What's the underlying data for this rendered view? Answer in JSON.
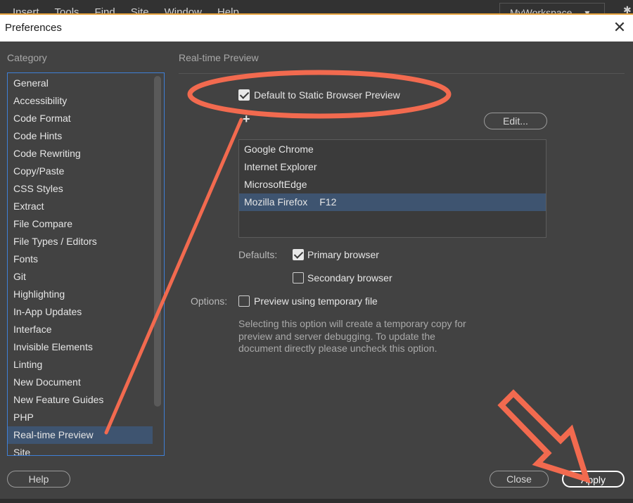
{
  "app_menu": {
    "items": [
      "Insert",
      "Tools",
      "Find",
      "Site",
      "Window",
      "Help"
    ],
    "workspace": "MyWorkspace",
    "workspace_arrow": "▾",
    "gear_glyph": "✱"
  },
  "dialog": {
    "title": "Preferences",
    "close_glyph": "✕",
    "category_label": "Category",
    "categories": [
      "General",
      "Accessibility",
      "Code Format",
      "Code Hints",
      "Code Rewriting",
      "Copy/Paste",
      "CSS Styles",
      "Extract",
      "File Compare",
      "File Types / Editors",
      "Fonts",
      "Git",
      "Highlighting",
      "In-App Updates",
      "Interface",
      "Invisible Elements",
      "Linting",
      "New Document",
      "New Feature Guides",
      "PHP",
      "Real-time Preview",
      "Site"
    ],
    "selected_category": "Real-time Preview"
  },
  "panel": {
    "section_title": "Real-time Preview",
    "default_static_label": "Default to Static Browser Preview",
    "default_static_checked": true,
    "add_glyph": "+",
    "edit_button": "Edit...",
    "browsers": [
      {
        "name": "Google Chrome",
        "key": ""
      },
      {
        "name": "Internet Explorer",
        "key": ""
      },
      {
        "name": "MicrosoftEdge",
        "key": ""
      },
      {
        "name": "Mozilla Firefox",
        "key": "F12"
      }
    ],
    "defaults_label": "Defaults:",
    "primary_label": "Primary browser",
    "primary_checked": true,
    "secondary_label": "Secondary browser",
    "secondary_checked": false,
    "options_label": "Options:",
    "temp_file_label": "Preview using temporary file",
    "temp_file_checked": false,
    "description": "Selecting this option will create a temporary copy for preview and server debugging. To update the document directly please uncheck this option."
  },
  "footer": {
    "help_button": "Help",
    "close_button": "Close",
    "apply_button": "Apply"
  },
  "colors": {
    "annotation": "#f26a4f",
    "selection": "#3e5470",
    "focus_border": "#3f7fd6",
    "accent_line": "#e5a13b"
  }
}
